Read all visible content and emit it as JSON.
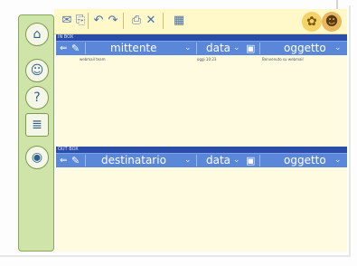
{
  "sidebar": {
    "buttons": [
      {
        "name": "Home",
        "icon": "home-icon"
      },
      {
        "name": "Contacts",
        "icon": "contacts-icon"
      },
      {
        "name": "Help",
        "icon": "help-icon"
      },
      {
        "name": "Notes",
        "icon": "notes-icon"
      },
      {
        "name": "Web",
        "icon": "globe-icon"
      }
    ]
  },
  "toolbar": {
    "icons": [
      "new-mail-icon",
      "attach-icon",
      "reply-icon",
      "forward-icon",
      "print-icon",
      "delete-icon",
      "calendar-icon",
      "settings-icon",
      "user-icon"
    ]
  },
  "inbox": {
    "label": "IN BOX",
    "columns": [
      "mittente",
      "data",
      "oggetto"
    ],
    "rows": [
      {
        "sender": "webmail team",
        "date": "oggi 10:23",
        "subject": "Benvenuto su webmail"
      }
    ]
  },
  "outbox": {
    "label": "OUT BOX",
    "columns": [
      "destinatario",
      "data",
      "oggetto"
    ],
    "rows": []
  },
  "colors": {
    "sidebar": "#cfe4a8",
    "toolbar": "#fff8c8",
    "section_label": "#2b4ca8",
    "header_bar": "#5a87d8"
  }
}
